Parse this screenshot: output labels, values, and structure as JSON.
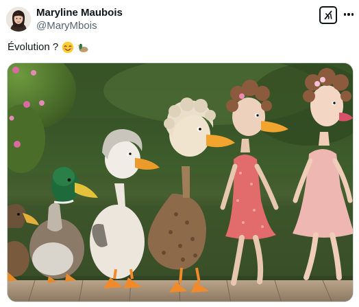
{
  "post": {
    "author": {
      "display_name": "Maryline Maubois",
      "handle": "@MaryMbois"
    },
    "text": "Évolution ?",
    "emojis": [
      "smiling-face-icon",
      "duck-icon"
    ],
    "media": {
      "type": "image"
    }
  },
  "colors": {
    "text_primary": "#0f1419",
    "text_secondary": "#536471",
    "border": "#cfd9de"
  }
}
